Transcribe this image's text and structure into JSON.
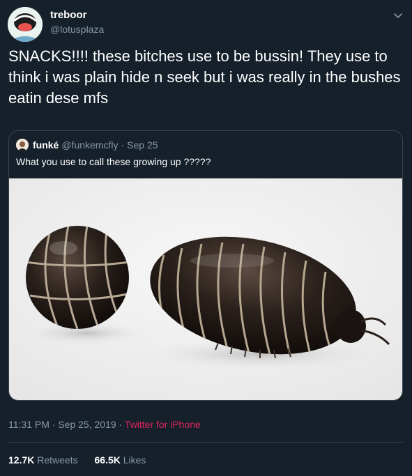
{
  "tweet": {
    "display_name": "treboor",
    "handle": "@lotusplaza",
    "text": "SNACKS!!!! these bitches use to be bussin! They use to think i was plain hide n seek but i was really in the bushes eatin dese mfs",
    "time": "11:31 PM",
    "date": "Sep 25, 2019",
    "separator": "·",
    "source": "Twitter for iPhone",
    "retweets_count": "12.7K",
    "retweets_label": "Retweets",
    "likes_count": "66.5K",
    "likes_label": "Likes"
  },
  "quote": {
    "display_name": "funké",
    "handle": "@funkemcfly",
    "separator": "·",
    "date": "Sep 25",
    "text": "What you use to call these growing up ?????"
  },
  "icons": {
    "caret": "chevron-down-icon"
  },
  "colors": {
    "background": "#15202b",
    "secondary_text": "#8899a6",
    "border": "#38444d",
    "source_link": "#e0245e"
  }
}
